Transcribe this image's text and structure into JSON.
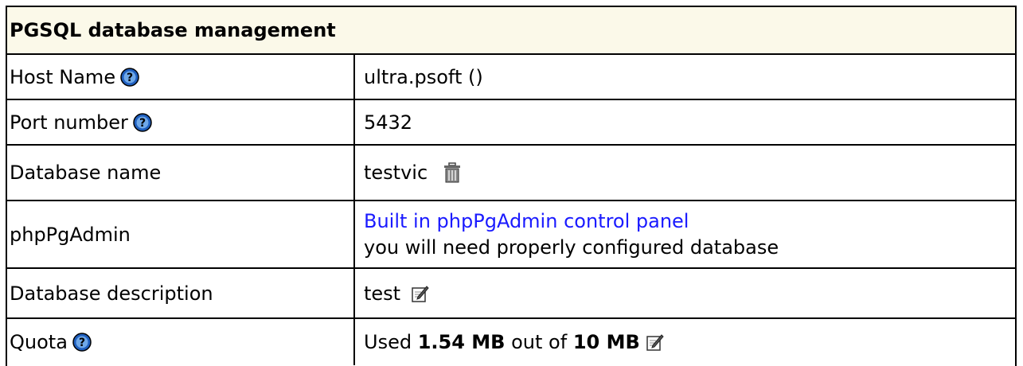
{
  "title": "PGSQL database management",
  "rows": {
    "host": {
      "label": "Host Name",
      "value": "ultra.psoft ()"
    },
    "port": {
      "label": "Port number",
      "value": "5432"
    },
    "dbname": {
      "label": "Database name",
      "value": "testvic"
    },
    "phppgadmin": {
      "label": "phpPgAdmin",
      "link": "Built in phpPgAdmin control panel",
      "note": "you will need properly configured database"
    },
    "description": {
      "label": "Database description",
      "value": "test"
    },
    "quota": {
      "label": "Quota",
      "used_prefix": "Used",
      "used": "1.54 MB",
      "out_of": "out of",
      "total": "10 MB"
    }
  },
  "icons": {
    "help": "help-icon",
    "trash": "trash-icon",
    "edit": "edit-icon"
  },
  "colors": {
    "header_bg": "#fbf9e9",
    "link": "#1a1aff",
    "help_icon": "#1f5fbf"
  }
}
